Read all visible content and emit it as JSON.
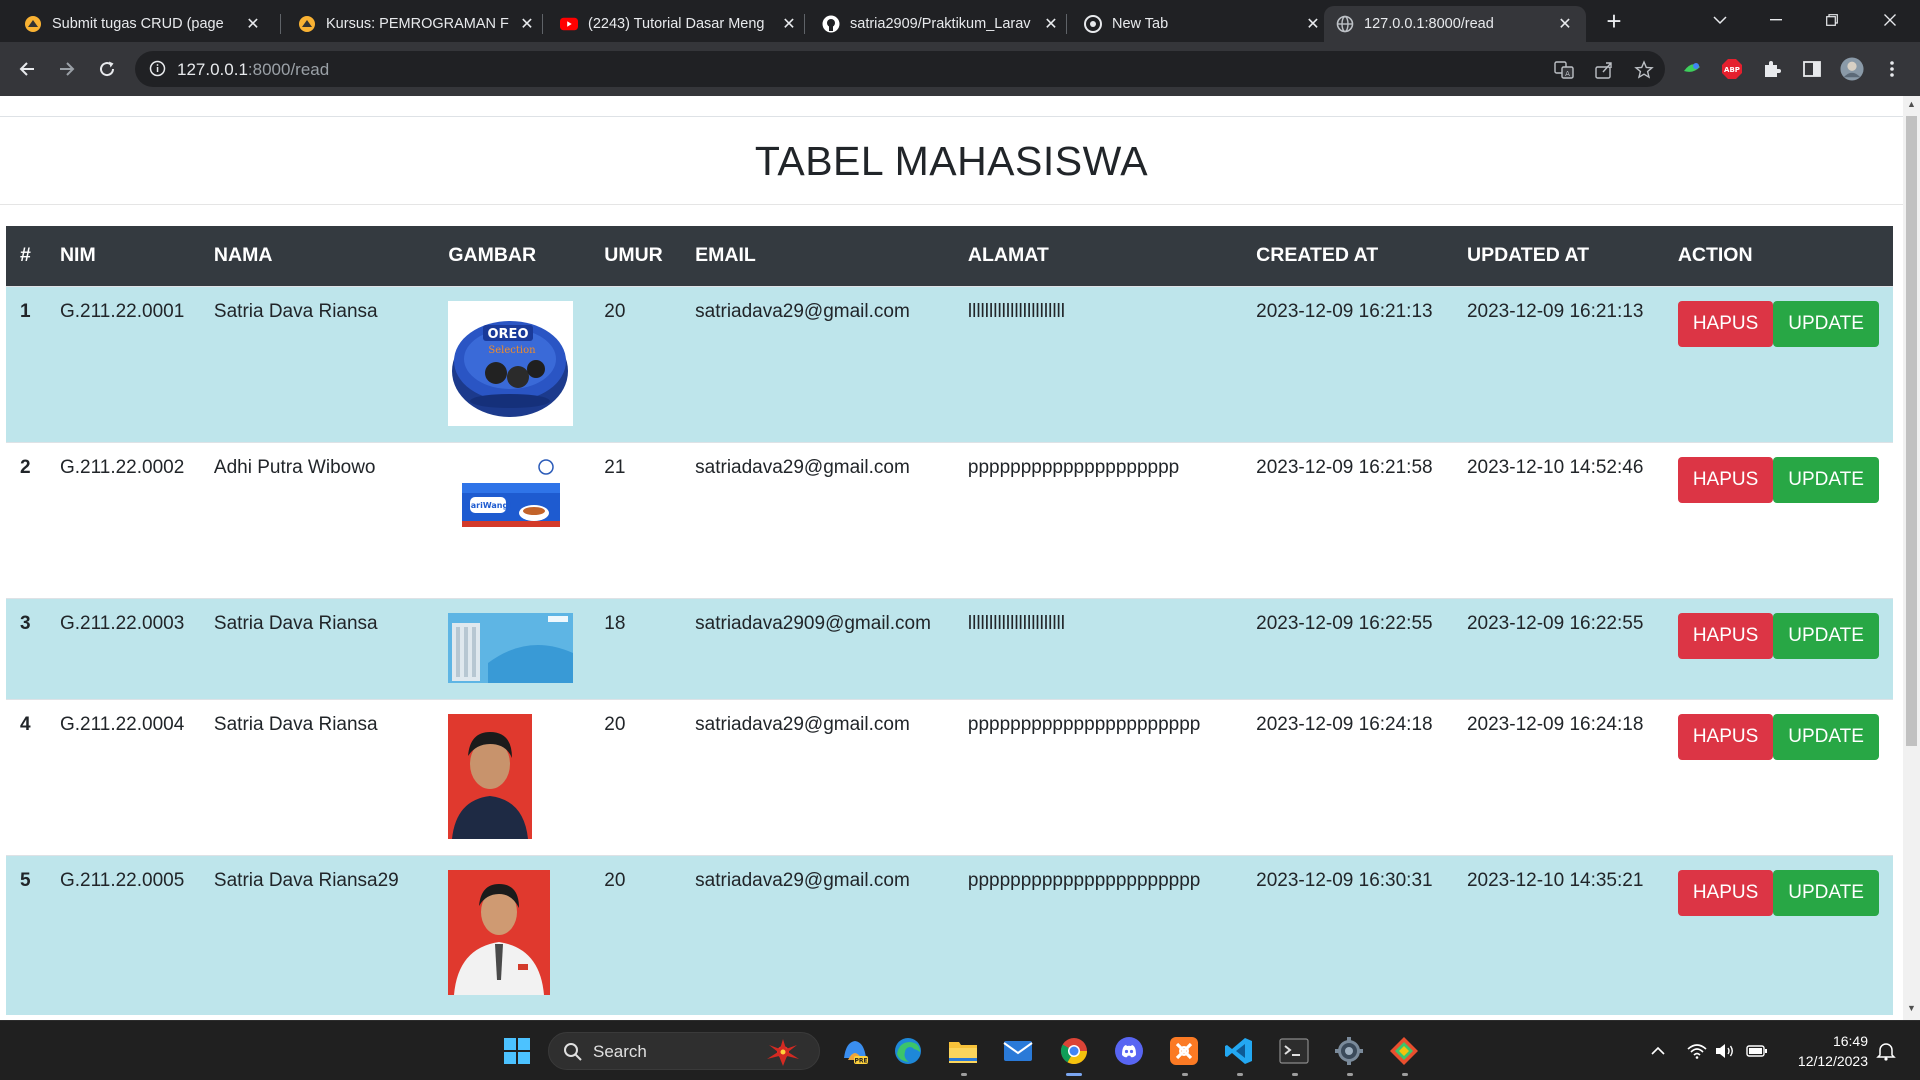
{
  "browser": {
    "tabs": [
      {
        "title": "Submit tugas CRUD (page",
        "icon": "moodle-icon"
      },
      {
        "title": "Kursus: PEMROGRAMAN F",
        "icon": "moodle-icon"
      },
      {
        "title": "(2243) Tutorial Dasar Meng",
        "icon": "youtube-icon"
      },
      {
        "title": "satria2909/Praktikum_Larav",
        "icon": "github-icon"
      },
      {
        "title": "New Tab",
        "icon": "chrome-icon"
      },
      {
        "title": "127.0.0.1:8000/read",
        "icon": "globe-icon"
      }
    ],
    "new_tab": "+",
    "url_host": "127.0.0.1",
    "url_path": ":8000/read"
  },
  "page": {
    "title": "TABEL MAHASISWA",
    "headers": [
      "#",
      "NIM",
      "NAMA",
      "GAMBAR",
      "UMUR",
      "EMAIL",
      "ALAMAT",
      "CREATED AT",
      "UPDATED AT",
      "ACTION"
    ],
    "delete_label": "HAPUS",
    "update_label": "UPDATE",
    "rows": [
      {
        "no": "1",
        "nim": "G.211.22.0001",
        "nama": "Satria Dava Riansa",
        "umur": "20",
        "email": "satriadava29@gmail.com",
        "alamat": "lllllllllllllllllllllll",
        "created": "2023-12-09 16:21:13",
        "updated": "2023-12-09 16:21:13",
        "image": "oreo-tin-image"
      },
      {
        "no": "2",
        "nim": "G.211.22.0002",
        "nama": "Adhi Putra Wibowo",
        "umur": "21",
        "email": "satriadava29@gmail.com",
        "alamat": "pppppppppppppppppppp",
        "created": "2023-12-09 16:21:58",
        "updated": "2023-12-10 14:52:46",
        "image": "sariwangi-tea-box-image"
      },
      {
        "no": "3",
        "nim": "G.211.22.0003",
        "nama": "Satria Dava Riansa",
        "umur": "18",
        "email": "satriadava2909@gmail.com",
        "alamat": "lllllllllllllllllllllll",
        "created": "2023-12-09 16:22:55",
        "updated": "2023-12-09 16:22:55",
        "image": "building-banner-image"
      },
      {
        "no": "4",
        "nim": "G.211.22.0004",
        "nama": "Satria Dava Riansa",
        "umur": "20",
        "email": "satriadava29@gmail.com",
        "alamat": "pppppppppppppppppppppp",
        "created": "2023-12-09 16:24:18",
        "updated": "2023-12-09 16:24:18",
        "image": "portrait-photo-image"
      },
      {
        "no": "5",
        "nim": "G.211.22.0005",
        "nama": "Satria Dava Riansa29",
        "umur": "20",
        "email": "satriadava29@gmail.com",
        "alamat": "pppppppppppppppppppppp",
        "created": "2023-12-09 16:30:31",
        "updated": "2023-12-10 14:35:21",
        "image": "portrait-uniform-photo-image"
      }
    ]
  },
  "taskbar": {
    "search_label": "Search",
    "time": "16:49",
    "date": "12/12/2023"
  },
  "colors": {
    "table_header": "#343a40",
    "striped_row": "#bee5eb",
    "danger": "#dc3545",
    "success": "#28a745"
  }
}
